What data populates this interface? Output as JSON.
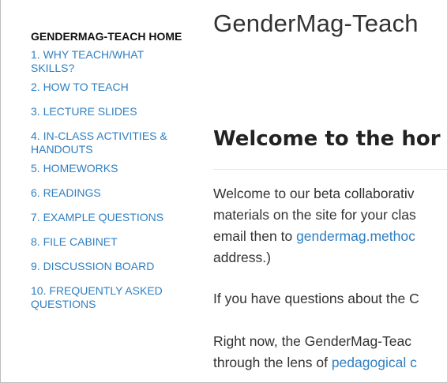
{
  "site": {
    "title": "GenderMag-Teach"
  },
  "sidebar": {
    "home": "GENDERMAG-TEACH HOME",
    "items": [
      {
        "line1": "1. WHY TEACH/WHAT",
        "line2": "SKILLS?"
      },
      {
        "line1": "2. HOW TO TEACH"
      },
      {
        "line1": "3. LECTURE SLIDES"
      },
      {
        "line1": "4. IN-CLASS ACTIVITIES &",
        "line2": "HANDOUTS"
      },
      {
        "line1": "5. HOMEWORKS"
      },
      {
        "line1": "6. READINGS"
      },
      {
        "line1": "7. EXAMPLE QUESTIONS"
      },
      {
        "line1": "8. FILE CABINET"
      },
      {
        "line1": "9. DISCUSSION BOARD"
      },
      {
        "line1": "10. FREQUENTLY ASKED",
        "line2": "QUESTIONS"
      }
    ]
  },
  "main": {
    "heading": "Welcome to the hor",
    "p1": {
      "line1": "Welcome to our beta collaborativ",
      "line2": "materials on the site for your clas",
      "line3_prefix": "email then to ",
      "line3_link": "gendermag.methoc",
      "line4": "address.)"
    },
    "p2": {
      "line1": "If you have questions about the C"
    },
    "p3": {
      "line1": "Right now, the GenderMag-Teac",
      "line2_prefix": "through the lens of ",
      "line2_link": "pedagogical c"
    }
  },
  "colors": {
    "link": "#2f7fc1",
    "text": "#333333",
    "heading": "#222222"
  }
}
